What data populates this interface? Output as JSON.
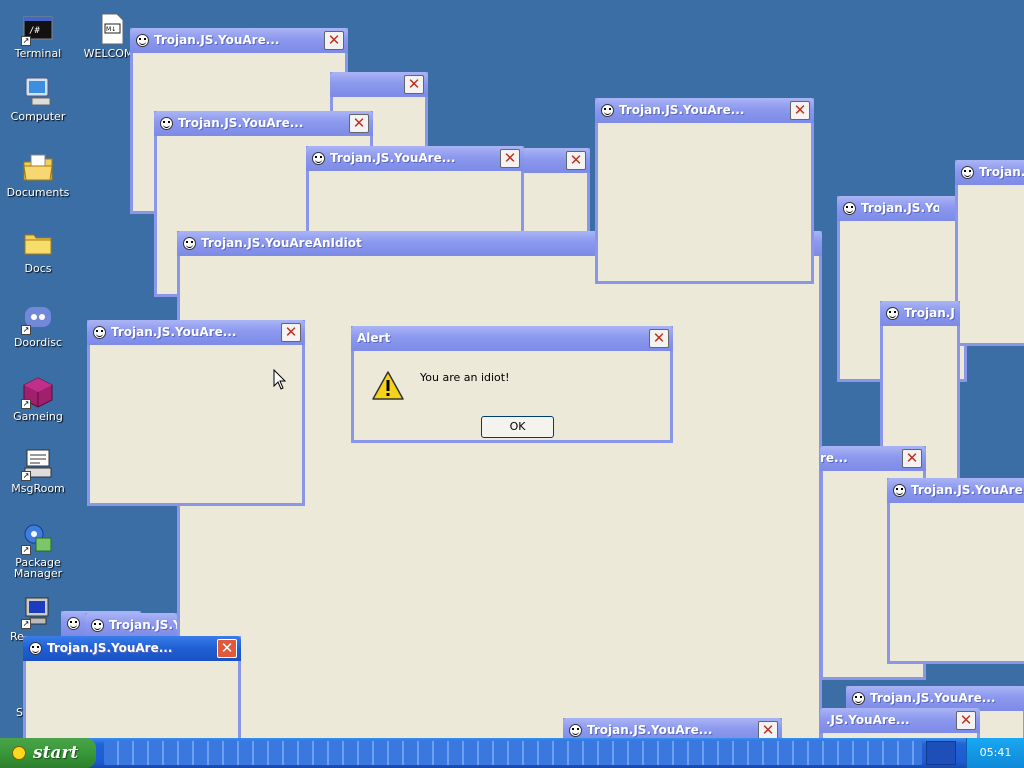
{
  "desktop_icons": [
    {
      "label": "Terminal",
      "icon": "terminal-icon",
      "glyph": "/#"
    },
    {
      "label": "WELCOME",
      "icon": "markdown-file-icon",
      "glyph": "M↓"
    },
    {
      "label": "Computer",
      "icon": "computer-icon"
    },
    {
      "label": "Documents",
      "icon": "documents-icon"
    },
    {
      "label": "Docs",
      "icon": "folder-icon"
    },
    {
      "label": "Doordisc",
      "icon": "doordisc-icon"
    },
    {
      "label": "Gameing",
      "icon": "game-cube-icon"
    },
    {
      "label": "MsgRoom",
      "icon": "msgroom-icon"
    },
    {
      "label": "Package Manager",
      "icon": "package-manager-icon"
    },
    {
      "label": "Re",
      "icon": "remote-desktop-icon"
    },
    {
      "label": "S",
      "icon": "generic-icon"
    }
  ],
  "popup_windows": [
    {
      "title": "Trojan.JS.YouAre...",
      "close": "✕"
    },
    {
      "title": "Trojan.JS.YouAre...",
      "close": "✕"
    },
    {
      "title": "",
      "close": "✕"
    },
    {
      "title": "Trojan.JS.YouAre...",
      "close": "✕"
    },
    {
      "title": "Trojan.JS.YouAre...",
      "close": "✕"
    },
    {
      "title": "",
      "close": "✕"
    },
    {
      "title": "Trojan.JS.YouAreAnIdiot",
      "close": "✕"
    },
    {
      "title": "Trojan.JS.YouAre...",
      "close": "✕"
    },
    {
      "title": "Trojan.JS.YouA",
      "close": "✕"
    },
    {
      "title": "Trojan.J",
      "close": "✕"
    },
    {
      "title": "Trojan.JS.YouAre...",
      "close": "✕"
    },
    {
      "title": "Trojan.",
      "close": "✕"
    },
    {
      "title": "re...",
      "close": "✕"
    },
    {
      "title": "Trojan.JS.YouAre...",
      "close": "✕"
    },
    {
      "title": "",
      "close": "✕"
    },
    {
      "title": "Trojan.JS.Y",
      "close": "✕"
    },
    {
      "title": "Trojan.JS.YouAre...",
      "close": "✕"
    },
    {
      "title": "Trojan.JS.YouAre...",
      "close": "✕"
    },
    {
      "title": ".JS.YouAre...",
      "close": "✕"
    },
    {
      "title": "Trojan.JS.YouAre...",
      "close": "✕"
    }
  ],
  "alert": {
    "title": "Alert",
    "close": "✕",
    "message": "You are an idiot!",
    "ok_label": "OK"
  },
  "taskbar": {
    "start_label": "start",
    "clock": "05:41"
  },
  "colors": {
    "desktop": "#3a6ea5",
    "titlebar": "#8b98ee",
    "window_body": "#ece9d8",
    "taskbar": "#1f63d6",
    "start_button": "#3a9a3a",
    "close_x": "#c0321f"
  }
}
